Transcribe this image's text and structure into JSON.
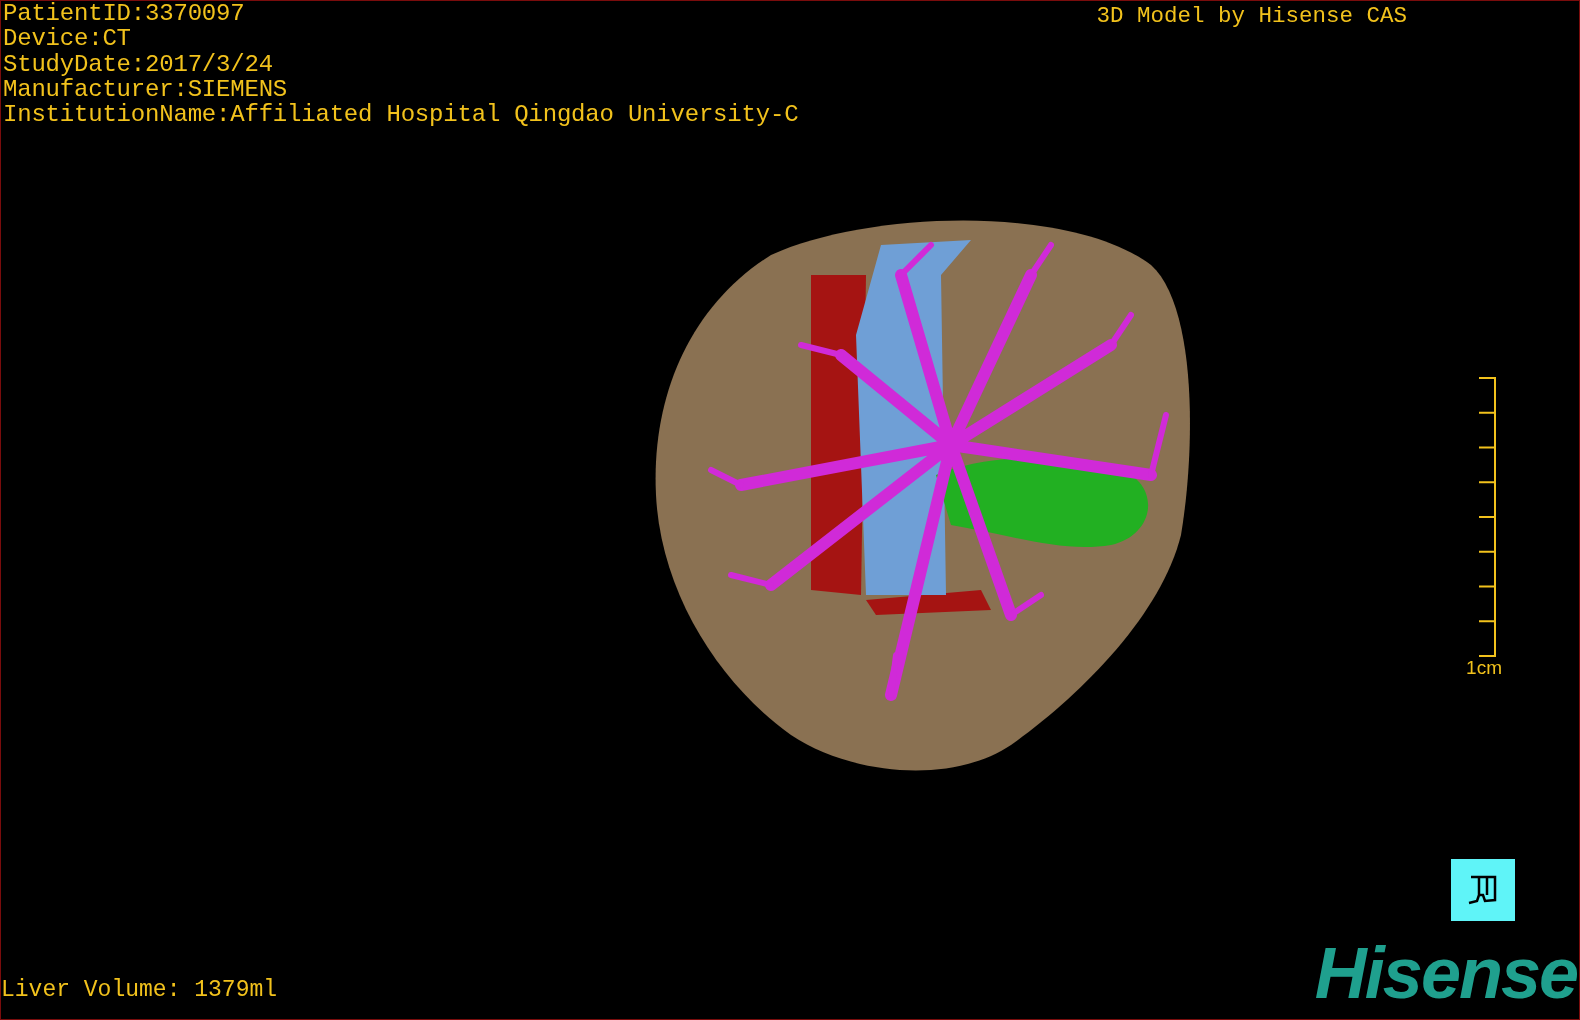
{
  "study_info": [
    "PatientID:3370097",
    "Device:CT",
    "StudyDate:2017/3/24",
    "Manufacturer:SIEMENS",
    "InstitutionName:Affiliated Hospital Qingdao University-C"
  ],
  "viewer_title": "3D Model by Hisense CAS",
  "scale_bar": {
    "label": "1cm"
  },
  "liver_volume": "Liver Volume: 1379ml",
  "logo": "Hisense"
}
